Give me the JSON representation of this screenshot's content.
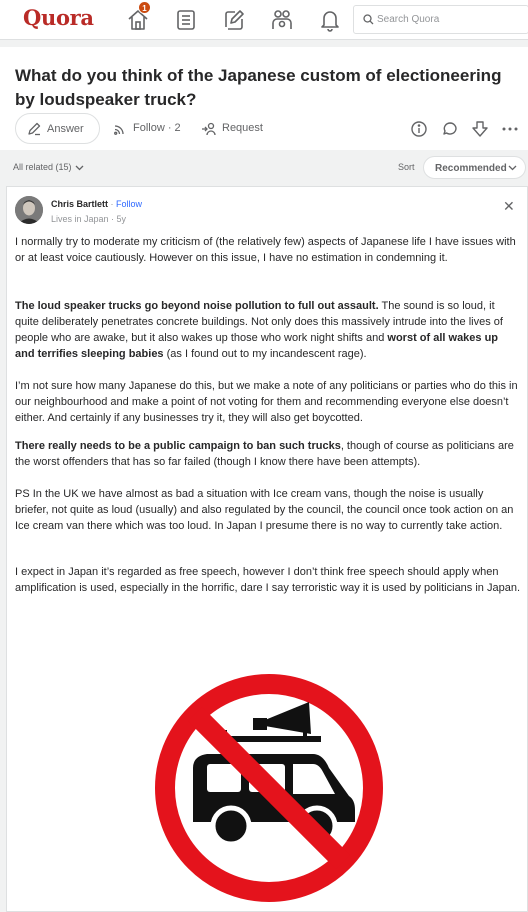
{
  "header": {
    "logo": "Quora",
    "notification_count": "1",
    "search_placeholder": "Search Quora"
  },
  "question": {
    "title": "What do you think of the Japanese custom of electioneering by loudspeaker truck?",
    "answer_label": "Answer",
    "follow_label": "Follow · 2",
    "request_label": "Request"
  },
  "filters": {
    "all_related": "All related (15)",
    "sort_label": "Sort",
    "sort_value": "Recommended"
  },
  "answer": {
    "author_name": "Chris Bartlett",
    "follow_link": "Follow",
    "credential": "Lives in Japan · 5y",
    "paragraphs": [
      {
        "text": "I normally try to moderate my criticism of (the relatively few) aspects of Japanese life I have issues with or at least voice cautiously. However on this issue, I have no estimation in condemning it."
      },
      {
        "bold1": "The loud speaker trucks go beyond noise pollution to full out assault.",
        "text1": " The sound is so loud, it quite deliberately penetrates concrete buildings. Not only does this massively intrude into the lives of people who are awake, but it also wakes up those who work night shifts and ",
        "bold2": "worst of all wakes up and terrifies sleeping babies",
        "text2": " (as I found out to my incandescent rage)."
      },
      {
        "text": "I’m not sure how many Japanese do this, but we make a note of any politicians or parties who do this in our neighbourhood and make a point of not voting for them and recommending everyone else doesn’t either. And certainly if any businesses try it, they will also get boycotted."
      },
      {
        "bold1": "There really needs to be a public campaign to ban such trucks",
        "text1": ", though of course as politicians are the worst offenders that has so far failed (though I know there have been attempts)."
      },
      {
        "text": "PS In the UK we have almost as bad a situation with Ice cream vans, though the noise is usually briefer, not quite as loud (usually) and also regulated by the council, the council once took action on an Ice cream van there which was too loud. In Japan I presume there is no way to currently take action."
      },
      {
        "text": "I expect in Japan it’s regarded as free speech, however I don’t think free speech should apply when amplification is used, especially in the horrific, dare I say terroristic way it is used by politicians in Japan."
      }
    ]
  },
  "colors": {
    "brand": "#b92b27",
    "link": "#2e69ff",
    "prohibition_red": "#e4131c"
  }
}
